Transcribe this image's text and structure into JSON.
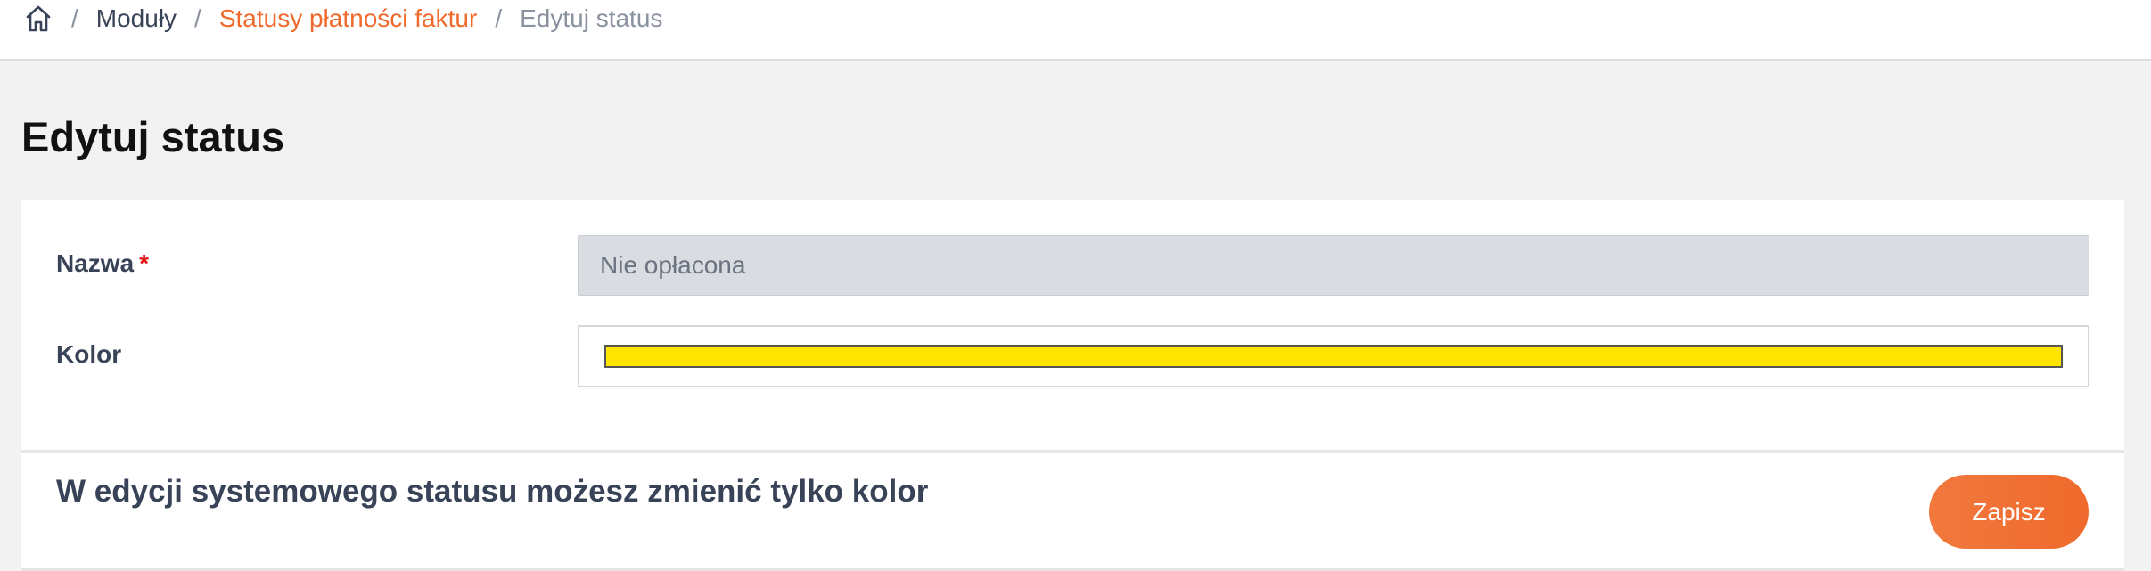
{
  "breadcrumb": {
    "home_icon": "home-icon",
    "separator": "/",
    "items": [
      {
        "label": "Moduły"
      },
      {
        "label": "Statusy płatności faktur"
      },
      {
        "label": "Edytuj status"
      }
    ]
  },
  "page": {
    "title": "Edytuj status"
  },
  "form": {
    "name": {
      "label": "Nazwa",
      "required_mark": "*",
      "value": "Nie opłacona"
    },
    "color": {
      "label": "Kolor",
      "value": "#ffe600"
    }
  },
  "footer": {
    "notice": "W edycji systemowego statusu możesz zmienić tylko kolor",
    "save_label": "Zapisz"
  },
  "colors": {
    "accent": "#ef6a2c",
    "required": "#e3171b"
  }
}
